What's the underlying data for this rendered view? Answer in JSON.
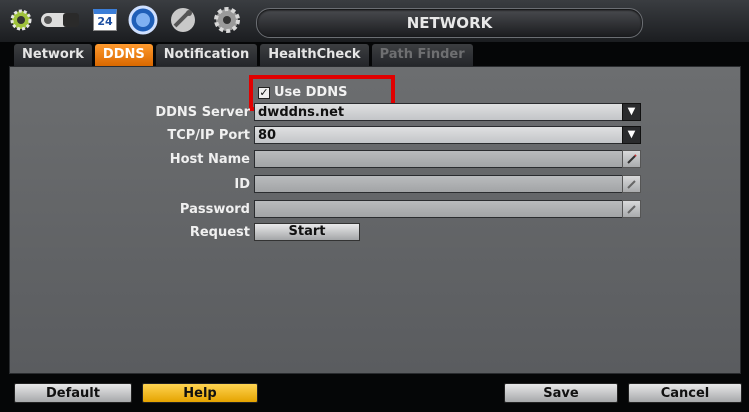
{
  "window": {
    "title": "NETWORK"
  },
  "toolbar_icons": [
    "gear-icon",
    "camera-icon",
    "calendar-icon",
    "network-globe-icon",
    "tools-icon",
    "settings-gear-icon"
  ],
  "calendar_day": "24",
  "tabs": [
    {
      "label": "Network",
      "state": "normal"
    },
    {
      "label": "DDNS",
      "state": "active"
    },
    {
      "label": "Notification",
      "state": "normal"
    },
    {
      "label": "HealthCheck",
      "state": "normal"
    },
    {
      "label": "Path Finder",
      "state": "disabled"
    }
  ],
  "form": {
    "use_ddns": {
      "label": "Use DDNS",
      "checked": true
    },
    "ddns_server": {
      "label": "DDNS Server",
      "value": "dwddns.net"
    },
    "tcp_ip_port": {
      "label": "TCP/IP Port",
      "value": "80"
    },
    "host_name": {
      "label": "Host Name",
      "value": ""
    },
    "id": {
      "label": "ID",
      "value": ""
    },
    "password": {
      "label": "Password",
      "value": ""
    },
    "request": {
      "label": "Request",
      "button": "Start"
    }
  },
  "footer": {
    "default": "Default",
    "help": "Help",
    "save": "Save",
    "cancel": "Cancel"
  },
  "colors": {
    "active_tab": "#f08a16",
    "highlight": "#e10000",
    "help_button": "#f5bb1a"
  }
}
